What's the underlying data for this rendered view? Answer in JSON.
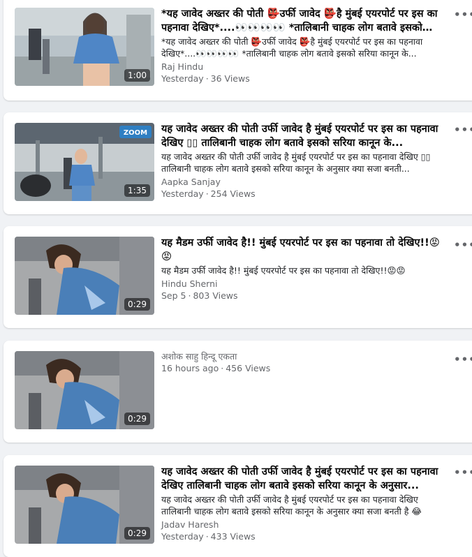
{
  "posts": [
    {
      "duration": "1:00",
      "title": "*यह जावेद अख्तर की पोती 👺उर्फी जावेद 👺है मुंबई एयरपोर्ट पर इस का पहनावा देखिए*....👀👀👀👀 *तालिबानी चाहक लोग बतावे इसको सरिया कानून के...",
      "description": "*यह जावेद अख्तर की पोती 👺उर्फी जावेद 👺है मुंबई एयरपोर्ट पर इस का पहनावा देखिए*....👀👀👀👀 *तालिबानी चाहक लोग बतावे इसको सरिया कानून के...",
      "author": "Raj Hindu",
      "date": "Yesterday",
      "views": "36 Views"
    },
    {
      "duration": "1:35",
      "thumb_logo": "ZOOM",
      "title": "यह जावेद अख्तर की पोती उर्फी जावेद है मुंबई एयरपोर्ट पर इस का पहनावा देखिए ▯▯ तालिबानी चाहक लोग बतावे इसको सरिया कानून के...",
      "description": "यह जावेद अख्तर की पोती उर्फी जावेद है मुंबई एयरपोर्ट पर इस का पहनावा देखिए ▯▯ तालिबानी चाहक लोग बतावे इसको सरिया कानून के अनुसार क्या सजा बनती...",
      "author": "Aapka Sanjay",
      "date": "Yesterday",
      "views": "254 Views"
    },
    {
      "duration": "0:29",
      "title": "यह मैडम उर्फी जावेद है!! मुंबई एयरपोर्ट पर इस का पहनावा तो देखिए!!😡😡",
      "description": "यह मैडम उर्फी जावेद है!! मुंबई एयरपोर्ट पर इस का पहनावा तो देखिए!!😡😡",
      "author": "Hindu Sherni",
      "date": "Sep 5",
      "views": "803 Views"
    },
    {
      "duration": "0:29",
      "title": "",
      "description": "",
      "author": "अशोक साहु हिन्दू एकता",
      "date": "16 hours ago",
      "views": "456 Views"
    },
    {
      "duration": "0:29",
      "title": "यह जावेद अख्तर की पोती उर्फी जावेद है मुंबई एयरपोर्ट पर इस का पहनावा देखिए तालिबानी चाहक लोग बतावे इसको सरिया कानून के अनुसार...",
      "description": "यह जावेद अख्तर की पोती उर्फी जावेद है मुंबई एयरपोर्ट पर इस का पहनावा देखिए तालिबानी चाहक लोग बतावे इसको सरिया कानून के अनुसार क्या सजा बनती है 😂",
      "author": "Jadav Haresh",
      "date": "Yesterday",
      "views": "433 Views"
    }
  ],
  "more_icon": "more-horizontal-icon",
  "separator": "·",
  "more_glyph": "•••",
  "colors": {
    "background": "#f0f2f5",
    "card": "#ffffff",
    "secondary_text": "#65676b"
  }
}
